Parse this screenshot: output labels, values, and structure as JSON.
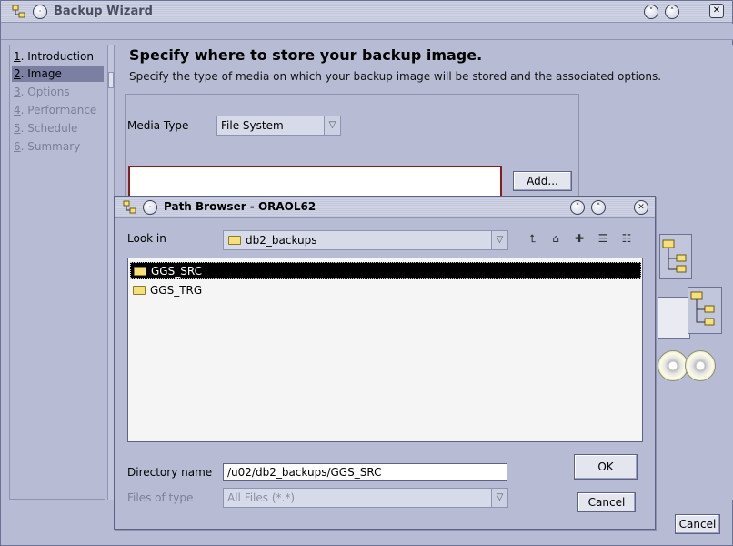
{
  "window": {
    "title": "Backup Wizard"
  },
  "nav": {
    "items": [
      {
        "num": "1",
        "label": ". Introduction",
        "state": "normal"
      },
      {
        "num": "2",
        "label": ". Image",
        "state": "selected"
      },
      {
        "num": "3",
        "label": ". Options",
        "state": "disabled"
      },
      {
        "num": "4",
        "label": ". Performance",
        "state": "disabled"
      },
      {
        "num": "5",
        "label": ". Schedule",
        "state": "disabled"
      },
      {
        "num": "6",
        "label": ". Summary",
        "state": "disabled"
      }
    ]
  },
  "page": {
    "heading": "Specify where to store your backup image.",
    "description": "Specify the type of media on which your backup image will be stored and the associated options.",
    "media_type_label": "Media Type",
    "media_type_value": "File System",
    "add_label": "Add...",
    "cancel_label": "Cancel"
  },
  "dialog": {
    "title": "Path Browser - ORAOL62",
    "look_in_label": "Look in",
    "look_in_value": "db2_backups",
    "files": [
      {
        "name": "GGS_SRC",
        "selected": true
      },
      {
        "name": "GGS_TRG",
        "selected": false
      }
    ],
    "directory_name_label": "Directory name",
    "directory_name_value": "/u02/db2_backups/GGS_SRC",
    "files_of_type_label": "Files of type",
    "files_of_type_value": "All Files (*.*)",
    "ok_label": "OK",
    "cancel_label": "Cancel"
  },
  "colors": {
    "window_bg": "#b7bcd4",
    "selection_nav": "#7b80a3",
    "selection_list": "#000000",
    "error_border": "#8e1b1b"
  }
}
